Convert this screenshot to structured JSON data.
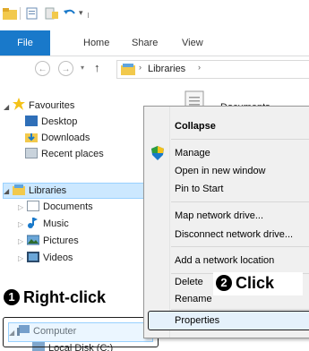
{
  "ribbon": {
    "tabs": [
      "File",
      "Home",
      "Share",
      "View"
    ]
  },
  "address": {
    "crumb": "Libraries"
  },
  "content": {
    "item": "Documents"
  },
  "nav": {
    "favourites": "Favourites",
    "favourites_items": [
      "Desktop",
      "Downloads",
      "Recent places"
    ],
    "libraries": "Libraries",
    "library_items": [
      "Documents",
      "Music",
      "Pictures",
      "Videos"
    ],
    "computer": "Computer",
    "local_disk": "Local Disk (C:)"
  },
  "context_menu": {
    "items": [
      "Collapse",
      "Manage",
      "Open in new window",
      "Pin to Start",
      "Map network drive...",
      "Disconnect network drive...",
      "Add a network location",
      "Delete",
      "Rename",
      "Properties"
    ]
  },
  "callouts": {
    "right_click": {
      "number": "1",
      "text": "Right-click"
    },
    "click": {
      "number": "2",
      "text": "Click"
    }
  },
  "colors": {
    "file_tab": "#1979ca",
    "selection": "#cce8ff",
    "callout_border": "#1e1e1e"
  }
}
